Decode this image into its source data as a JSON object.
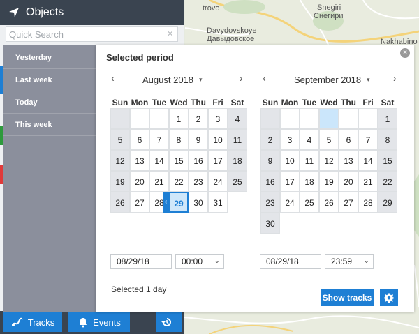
{
  "map": {
    "labels": [
      "trovo",
      "Snegiri",
      "Снегири",
      "Davydovskoye",
      "Давыдовское",
      "Nakhabino"
    ]
  },
  "objects_panel": {
    "title": "Objects",
    "search_placeholder": "Quick Search",
    "clear_icon": "×",
    "strip_colors": [
      "#1e7fd4",
      "#2e9a3c",
      "#e03a3a"
    ],
    "bottom_buttons": {
      "tracks": "Tracks",
      "events": "Events"
    }
  },
  "period_sidebar": {
    "items": [
      "Yesterday",
      "Last week",
      "Today",
      "This week"
    ]
  },
  "dialog": {
    "title": "Selected period",
    "close_icon": "×",
    "prev_arrow": "‹",
    "next_arrow": "›",
    "dropdown_caret": "▾",
    "selected_left_arrow": "‹",
    "selected_right_arrow": "›",
    "dash": "—",
    "weekdays": [
      "Sun",
      "Mon",
      "Tue",
      "Wed",
      "Thu",
      "Fri",
      "Sat"
    ],
    "left_month": {
      "label": "August 2018",
      "weeks": [
        [
          "",
          "",
          "",
          "1",
          "2",
          "3",
          "4"
        ],
        [
          "5",
          "6",
          "7",
          "8",
          "9",
          "10",
          "11"
        ],
        [
          "12",
          "13",
          "14",
          "15",
          "16",
          "17",
          "18"
        ],
        [
          "19",
          "20",
          "21",
          "22",
          "23",
          "24",
          "25"
        ],
        [
          "26",
          "27",
          "28",
          "29",
          "30",
          "31",
          ""
        ]
      ],
      "selected_day": "29"
    },
    "right_month": {
      "label": "September 2018",
      "weeks": [
        [
          "",
          "",
          "",
          "",
          "",
          "",
          "1"
        ],
        [
          "2",
          "3",
          "4",
          "5",
          "6",
          "7",
          "8"
        ],
        [
          "9",
          "10",
          "11",
          "12",
          "13",
          "14",
          "15"
        ],
        [
          "16",
          "17",
          "18",
          "19",
          "20",
          "21",
          "22"
        ],
        [
          "23",
          "24",
          "25",
          "26",
          "27",
          "28",
          "29"
        ],
        [
          "30",
          "",
          "",
          "",
          "",
          "",
          ""
        ]
      ]
    },
    "from_date": "08/29/18",
    "from_time": "00:00",
    "to_date": "08/29/18",
    "to_time": "23:59",
    "selected_info": "Selected 1 day",
    "show_tracks_label": "Show tracks"
  }
}
